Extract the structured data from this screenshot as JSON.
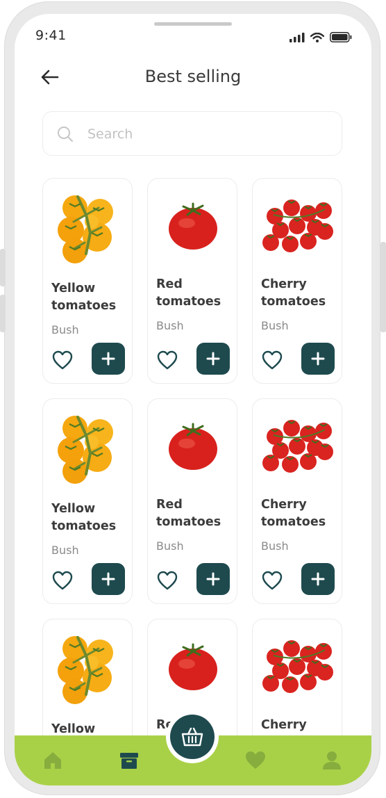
{
  "status": {
    "time": "9:41"
  },
  "header": {
    "title": "Best selling"
  },
  "search": {
    "placeholder": "Search"
  },
  "products": [
    {
      "name": "Yellow tomatoes",
      "sub": "Bush",
      "image": "yellow-tomatoes"
    },
    {
      "name": "Red tomatoes",
      "sub": "Bush",
      "image": "red-tomato"
    },
    {
      "name": "Cherry tomatoes",
      "sub": "Bush",
      "image": "cherry-tomatoes"
    },
    {
      "name": "Yellow tomatoes",
      "sub": "Bush",
      "image": "yellow-tomatoes"
    },
    {
      "name": "Red tomatoes",
      "sub": "Bush",
      "image": "red-tomato"
    },
    {
      "name": "Cherry tomatoes",
      "sub": "Bush",
      "image": "cherry-tomatoes"
    },
    {
      "name": "Yellow",
      "sub": "",
      "image": "yellow-tomatoes"
    },
    {
      "name": "Re",
      "sub": "",
      "image": "red-tomato"
    },
    {
      "name": "Cherry",
      "sub": "",
      "image": "cherry-tomatoes"
    }
  ],
  "tabbar": {
    "items": [
      "home-icon",
      "box-icon",
      "basket-icon",
      "heart-icon",
      "profile-icon"
    ],
    "active": "box-icon"
  },
  "colors": {
    "accent": "#1e4a4e",
    "tabbar": "#a9d148",
    "active_tab": "#1e4a4e",
    "inactive_tab": "#7fa63a"
  }
}
